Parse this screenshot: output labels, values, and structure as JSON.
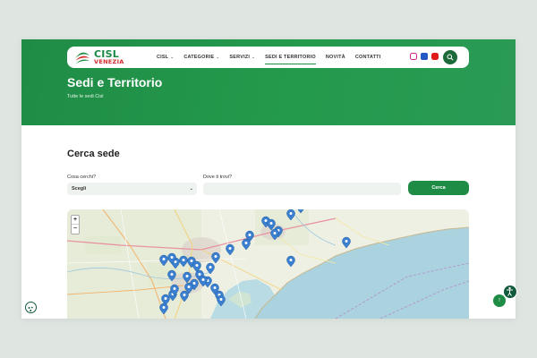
{
  "header": {
    "logo": {
      "brand": "CISL",
      "subbrand": "VENEZIA"
    },
    "menu": [
      {
        "label": "CISL",
        "has_dropdown": true,
        "active": false
      },
      {
        "label": "CATEGORIE",
        "has_dropdown": true,
        "active": false
      },
      {
        "label": "SERVIZI",
        "has_dropdown": true,
        "active": false
      },
      {
        "label": "SEDI E TERRITORIO",
        "has_dropdown": false,
        "active": true
      },
      {
        "label": "NOVITÀ",
        "has_dropdown": false,
        "active": false
      },
      {
        "label": "CONTATTI",
        "has_dropdown": false,
        "active": false
      }
    ],
    "social_icons": [
      "instagram-icon",
      "facebook-icon",
      "youtube-icon"
    ],
    "search_icon": "search-icon"
  },
  "hero": {
    "title": "Sedi e Territorio",
    "breadcrumb": "Tutte le sedi Cisl"
  },
  "search": {
    "section_title": "Cerca sede",
    "what_label": "Cosa cerchi?",
    "what_value": "Scegli",
    "where_label": "Dove ti trovi?",
    "where_value": "",
    "submit_label": "Cerca"
  },
  "map": {
    "zoom_in": "+",
    "zoom_out": "−",
    "marker_count": 34
  },
  "colors": {
    "brand_green": "#1f8c46",
    "dark_green": "#0f5a3a",
    "brand_red": "#d42b2b",
    "marker_blue": "#3b7fd0",
    "sea": "#aad3df",
    "land": "#eef0e4"
  },
  "floating": {
    "accessibility_icon": "accessibility-icon",
    "back_to_top_icon": "arrow-up-icon",
    "cookie_icon": "cookie-icon"
  }
}
